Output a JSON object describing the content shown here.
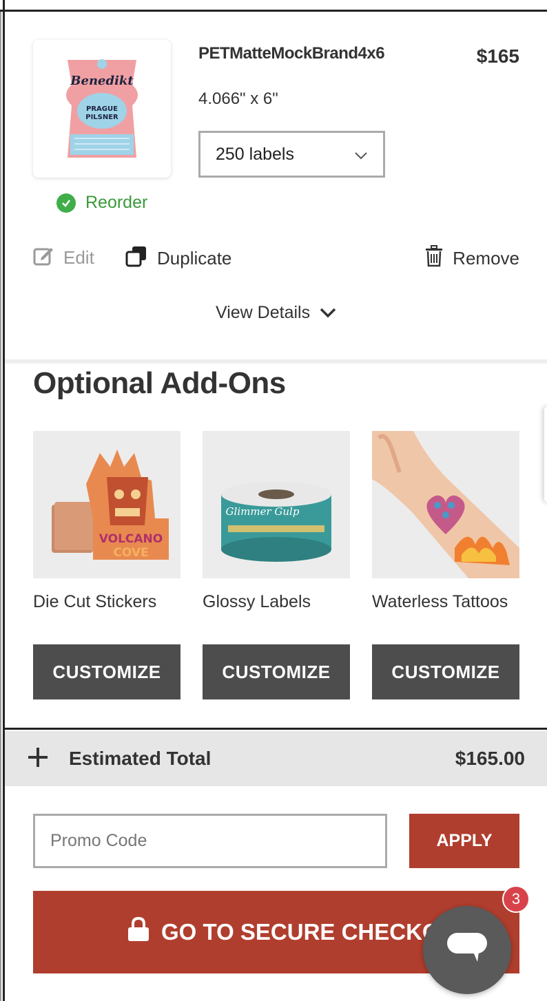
{
  "cart_item": {
    "name": "PETMatteMockBrand4x6",
    "price": "$165",
    "size": "4.066\" x 6\"",
    "quantity": "250 labels",
    "reorder_label": "Reorder",
    "thumbnail_text": {
      "brand": "Benedikt",
      "product_line1": "PRAGUE",
      "product_line2": "PILSNER"
    },
    "actions": {
      "edit": "Edit",
      "duplicate": "Duplicate",
      "remove": "Remove"
    },
    "view_details": "View Details"
  },
  "addons": {
    "title": "Optional Add-Ons",
    "items": [
      {
        "name": "Die Cut Stickers",
        "button": "CUSTOMIZE",
        "img_text1": "VOLCANO",
        "img_text2": "COVE"
      },
      {
        "name": "Glossy Labels",
        "button": "CUSTOMIZE",
        "img_text1": "Glimmer Gulp"
      },
      {
        "name": "Waterless Tattoos",
        "button": "CUSTOMIZE"
      }
    ]
  },
  "summary": {
    "estimated_total_label": "Estimated Total",
    "estimated_total_value": "$165.00"
  },
  "promo": {
    "placeholder": "Promo Code",
    "apply_label": "APPLY"
  },
  "checkout": {
    "label": "GO TO SECURE CHECKOUT"
  },
  "chat": {
    "badge_count": "3"
  },
  "colors": {
    "accent": "#b03e2e",
    "button_dark": "#4d4d4d",
    "success": "#3fae49",
    "badge": "#d8434b"
  }
}
